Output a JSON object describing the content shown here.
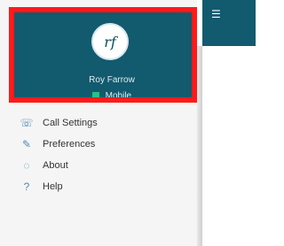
{
  "header": {
    "avatar_initials": "rf",
    "user_name": "Roy Farrow",
    "presence": "Mobile"
  },
  "menu": {
    "items": [
      {
        "label": "Call Settings",
        "icon": "phone-settings-icon"
      },
      {
        "label": "Preferences",
        "icon": "preferences-icon"
      },
      {
        "label": "About",
        "icon": "info-icon"
      },
      {
        "label": "Help",
        "icon": "help-icon"
      }
    ]
  },
  "toolbar": {
    "right_icon": "list-icon"
  },
  "colors": {
    "primary": "#125a6e",
    "highlight": "#ff1a1a",
    "presence_green": "#26c281",
    "menu_icon": "#4f89b2"
  }
}
